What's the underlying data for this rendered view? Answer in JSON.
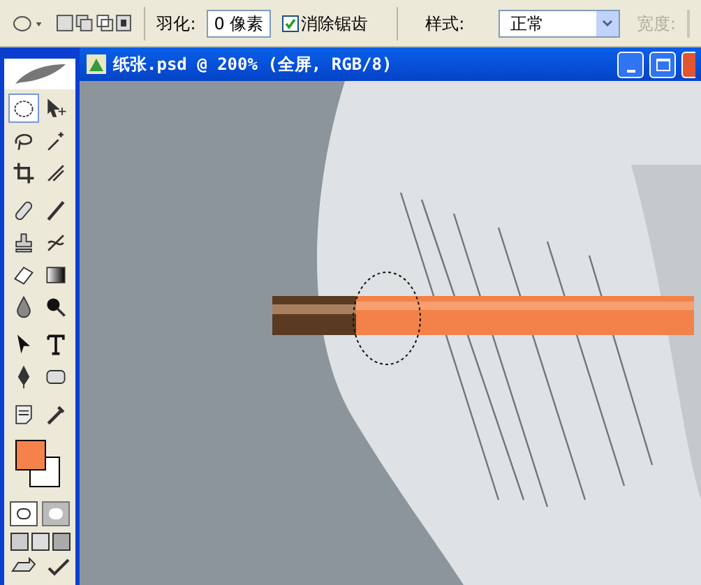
{
  "options_bar": {
    "feather_label": "羽化:",
    "feather_value": "0 像素",
    "antialias": {
      "label": "消除锯齿",
      "checked": true
    },
    "style_label": "样式:",
    "style_value": "正常",
    "width_label": "宽度:",
    "width_disabled": true
  },
  "toolbox": {
    "tools": [
      {
        "selected": true
      },
      {
        "selected": false
      },
      {
        "selected": false
      },
      {
        "selected": false
      },
      {
        "selected": false
      },
      {
        "selected": false
      },
      {
        "selected": false
      },
      {
        "selected": false
      },
      {
        "selected": false
      },
      {
        "selected": false
      },
      {
        "selected": false
      },
      {
        "selected": false
      },
      {
        "selected": false
      },
      {
        "selected": false
      },
      {
        "selected": false
      },
      {
        "selected": false
      },
      {
        "selected": false
      },
      {
        "selected": false
      },
      {
        "selected": false
      },
      {
        "selected": false
      }
    ],
    "mask_modes": [
      {
        "selected": true
      },
      {
        "selected": false
      }
    ]
  },
  "document": {
    "title": "纸张.psd @ 200% (全屏, RGB/8)"
  }
}
